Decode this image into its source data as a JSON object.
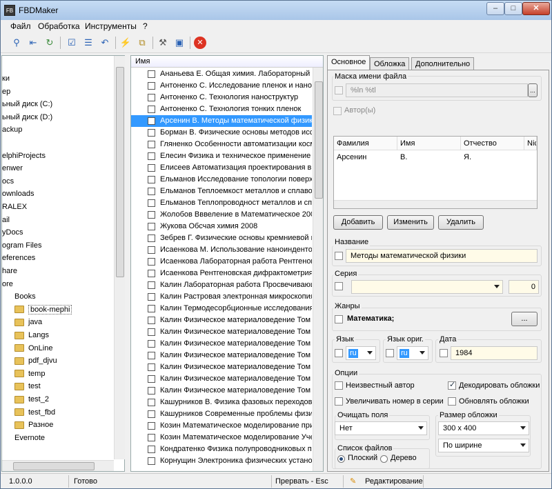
{
  "window": {
    "title": "FBDMaker",
    "icon": "FB"
  },
  "menu": [
    "Файл",
    "Обработка",
    "Инструменты",
    "?"
  ],
  "toolbar_icons": [
    "magnifier-icon",
    "export-icon",
    "refresh-icon",
    "check-icon",
    "list-icon",
    "undo-icon",
    "lightning-icon",
    "copy-icon",
    "tools-icon",
    "books-icon",
    "stop-icon"
  ],
  "tree": {
    "items": [
      "ки",
      "ер",
      "ьный диск (C:)",
      "ьный диск (D:)",
      "ackup",
      "",
      "elphiProjects",
      "enwer",
      "ocs",
      "ownloads",
      "RALEX",
      "ail",
      "yDocs",
      "ogram Files",
      "eferences",
      "hare",
      "ore",
      "Books"
    ],
    "folders": [
      "book-mephi",
      "java",
      "Langs",
      "OnLine",
      "pdf_djvu",
      "temp",
      "test",
      "test_2",
      "test_fbd",
      "Разное"
    ],
    "last": "Evernote"
  },
  "list": {
    "header": "Имя",
    "rows": [
      "Ананьева Е. Общая химия. Лабораторный пра",
      "Антоненко  С. Исследование пленок и наностр",
      "Антоненко  С. Технология наноструктур",
      "Антоненко  С. Технология тонких пленок",
      "Арсенин В. Методы математической физики",
      "Борман  В. Физические основы методов исслед",
      "Гляненко Особенности автоматизации космоф",
      "Елесин Физика и техническое применение нан",
      "Елисеев Автоматизация проектирования в про",
      "Ельманов Исследование топологии поверхност",
      "Ельманов Теплоемкост металлов и сплавов 200",
      "Ельманов Теплопроводност металлов и сплаво",
      "Жолобов Вввеление в Математическое 2008",
      "Жукова Обсчая химия 2008",
      "Зебрев  Г. Физические основы кремниевой нан",
      "Исаенкова  М. Использование наноиндентоме",
      "Исаенкова Лабораторная работа Рентгеногра",
      "Исаенкова Рентгеновская дифрактометрия 20",
      "Калин Лабораторная работа Просвечивающа",
      "Калин Растровая электронная микроскопия 2(",
      "Калин Термодесорбционные исследования по",
      "Калин Физическое материаловедение Том 1 Ф",
      "Калин Физическое материаловедение Том 2 Ф",
      "Калин Физическое материаловедение Том 3 2(",
      "Калин Физическое материаловедение Том 4 2(",
      "Калин Физическое материаловедение Том 5 2(",
      "Калин Физическое материаловедение Том 6 Ч",
      "Калин Физическое материаловедение Том 6 Ч",
      "Кашурников В. Физика фазовых переходов",
      "Кашурников Современные проблемы физики т",
      "Козин Математическое моделирование пример",
      "Козин Математическое моделирование Учебн",
      "Кондратенко Физика полупроводниковых пр",
      "Корнущин Электроника физических установок"
    ],
    "selected_index": 4
  },
  "tabs": [
    "Основное",
    "Обложка",
    "Дополнительно"
  ],
  "form": {
    "mask_label": "Маска имени файла",
    "mask_value": "%ln %tl",
    "ellipsis": "...",
    "authors_label": "Автор(ы)",
    "grid_headers": [
      "Фамилия",
      "Имя",
      "Отчество",
      "Nic"
    ],
    "grid_row": [
      "Арсенин",
      "В.",
      "Я.",
      ""
    ],
    "btn_add": "Добавить",
    "btn_edit": "Изменить",
    "btn_delete": "Удалить",
    "title_label": "Название",
    "title_value": "Методы математической физики",
    "series_label": "Серия",
    "series_value": "",
    "series_num": "0",
    "genres_label": "Жанры",
    "genres_value": "Математика;",
    "genres_btn": "...",
    "lang_label": "Язык",
    "lang_value": "ru",
    "lang_orig_label": "Язык ориг.",
    "lang_orig_value": "ru",
    "date_label": "Дата",
    "date_value": "1984",
    "options_label": "Опции",
    "opt_unknown_author": "Неизвестный автор",
    "opt_decode_covers": "Декодировать обложки",
    "opt_increase_series": "Увеличивать номер в серии",
    "opt_update_covers": "Обновлять обложки",
    "clear_fields_label": "Очищать поля",
    "clear_fields_value": "Нет",
    "cover_size_label": "Размер обложки",
    "cover_size_value": "300 x 400",
    "cover_fit_value": "По ширине",
    "file_list_label": "Список файлов",
    "radio_flat": "Плоский",
    "radio_tree": "Дерево"
  },
  "status": {
    "version": "1.0.0.0",
    "state": "Готово",
    "abort": "Прервать - Esc",
    "mode": "Редактирование"
  }
}
